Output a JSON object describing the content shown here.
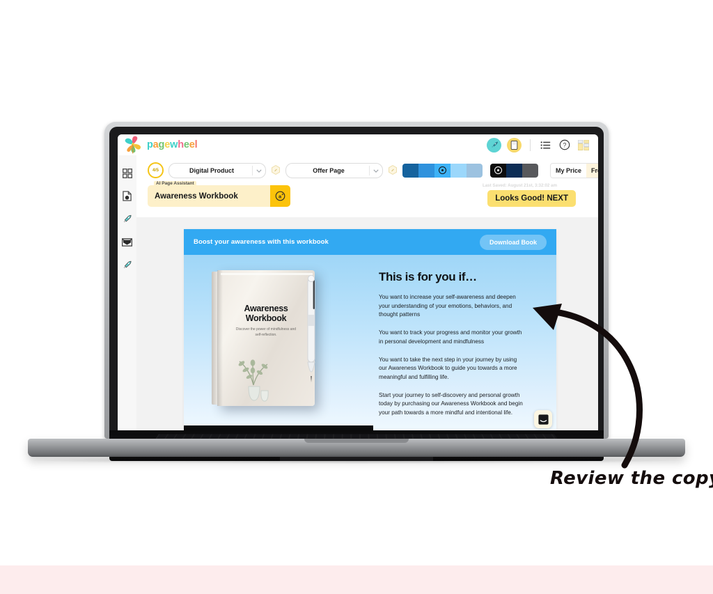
{
  "app": {
    "logo_text": "pagewheel",
    "logo_letters": [
      {
        "ch": "p",
        "color": "#3fd0c9"
      },
      {
        "ch": "a",
        "color": "#f8a03c"
      },
      {
        "ch": "g",
        "color": "#72c472"
      },
      {
        "ch": "e",
        "color": "#f5d24a"
      },
      {
        "ch": "w",
        "color": "#3fd0c9"
      },
      {
        "ch": "h",
        "color": "#ef6f8e"
      },
      {
        "ch": "e",
        "color": "#72c472"
      },
      {
        "ch": "e",
        "color": "#f8a03c"
      },
      {
        "ch": "l",
        "color": "#f3766a"
      }
    ]
  },
  "header": {
    "icons": [
      {
        "name": "rocket-icon",
        "glyph": "🚀",
        "style": "teal"
      },
      {
        "name": "book-icon",
        "glyph": "📕",
        "style": "yellow"
      }
    ],
    "list_icon": "list-icon",
    "help_icon": "help-icon",
    "apps_icon": "apps-grid-icon"
  },
  "sidebar": {
    "items": [
      {
        "name": "sidebar-item-dashboard",
        "icon": "grid-icon"
      },
      {
        "name": "sidebar-item-pages",
        "icon": "document-icon"
      },
      {
        "name": "sidebar-item-launch",
        "icon": "rocket-icon"
      },
      {
        "name": "sidebar-item-email",
        "icon": "envelope-icon"
      },
      {
        "name": "sidebar-item-publish",
        "icon": "rocket-icon"
      }
    ]
  },
  "toolbar": {
    "progress": "4/5",
    "product_type": "Digital Product",
    "page_type": "Offer Page",
    "palette_primary": {
      "name": "primary-color-palette",
      "selected_index": 2,
      "swatches": [
        "#15639e",
        "#2f92dd",
        "#3db2f7",
        "#9bd7fb",
        "#9cc2e0"
      ]
    },
    "palette_secondary": {
      "name": "text-color-palette",
      "selected_index": 0,
      "swatches": [
        "#0d0d0d",
        "#0d2d55",
        "#58595c"
      ]
    },
    "price_label": "My Price",
    "price_value": "Free",
    "ai_assistant_legend": "AI Page Assistant",
    "ai_assistant_value": "Awareness Workbook",
    "ai_button_icon": "ai-sparkle-icon",
    "last_saved": "Last Saved: August 21st, 3:32:02 am",
    "next_button": "Looks Good! NEXT"
  },
  "preview": {
    "topbar_text": "Boost your awareness with this workbook",
    "download_button": "Download Book",
    "headline": "This is for you if…",
    "paragraphs": [
      "You want to increase your self-awareness and deepen your understanding of your emotions, behaviors, and thought patterns",
      "You want to track your progress and monitor your growth in personal development and mindfulness",
      "You want to take the next step in your journey by using our Awareness Workbook to guide you towards a more meaningful and fulfilling life.",
      "Start your journey to self-discovery and personal growth today by purchasing our Awareness Workbook and begin your path towards a more mindful and intentional life."
    ],
    "book": {
      "title_line1": "Awareness",
      "title_line2": "Workbook",
      "subtitle": "Discover the power of mindfulness and self-reflection."
    },
    "chat_widget_icon": "chat-bubble-icon"
  },
  "annotation": {
    "text": "Review the copy",
    "arrow": "curved-arrow-icon"
  },
  "colors": {
    "accent_yellow": "#fbdf70",
    "accent_blue": "#32a9f2",
    "pink_band": "#fdeced"
  }
}
